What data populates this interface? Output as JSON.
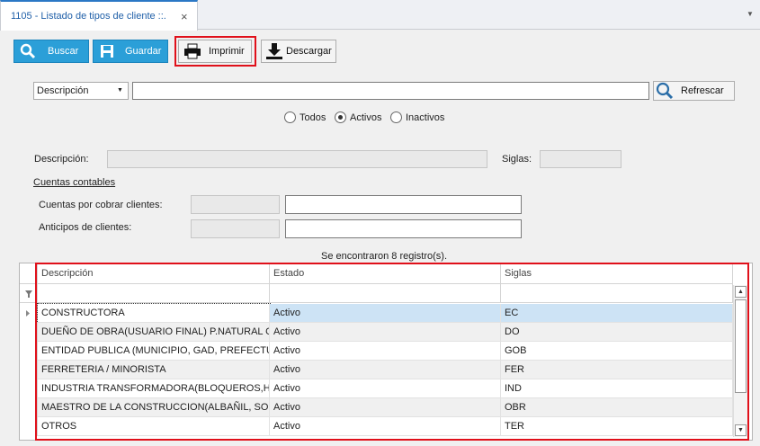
{
  "tab": {
    "title": "1105 - Listado de tipos de cliente ::.",
    "close": "×",
    "menu": "▼"
  },
  "toolbar": {
    "buscar": "Buscar",
    "guardar": "Guardar",
    "imprimir": "Imprimir",
    "descargar": "Descargar"
  },
  "search": {
    "field": "Descripción",
    "value": "",
    "refrescar": "Refrescar"
  },
  "filter": {
    "todos": "Todos",
    "activos": "Activos",
    "inactivos": "Inactivos",
    "selected": "Activos"
  },
  "form": {
    "descripcion_label": "Descripción:",
    "siglas_label": "Siglas:",
    "cuentas_title": "Cuentas contables",
    "cxc_label": "Cuentas por cobrar clientes:",
    "anticipos_label": "Anticipos de clientes:"
  },
  "records_msg": "Se encontraron 8 registro(s).",
  "grid": {
    "headers": [
      "Descripción",
      "Estado",
      "Siglas"
    ],
    "rows": [
      [
        "CONSTRUCTORA",
        "Activo",
        "EC"
      ],
      [
        "DUEÑO DE OBRA(USUARIO FINAL) P.NATURAL O...",
        "Activo",
        "DO"
      ],
      [
        "ENTIDAD PUBLICA (MUNICIPIO, GAD, PREFECTU...",
        "Activo",
        "GOB"
      ],
      [
        "FERRETERIA / MINORISTA",
        "Activo",
        "FER"
      ],
      [
        "INDUSTRIA TRANSFORMADORA(BLOQUEROS,HO...",
        "Activo",
        "IND"
      ],
      [
        "MAESTRO DE LA CONSTRUCCION(ALBAÑIL, SOL...",
        "Activo",
        "OBR"
      ],
      [
        "OTROS",
        "Activo",
        "TER"
      ]
    ]
  },
  "colors": {
    "accent": "#2b9fd8",
    "highlight": "#e0101a",
    "selected_row": "#cde3f5"
  }
}
